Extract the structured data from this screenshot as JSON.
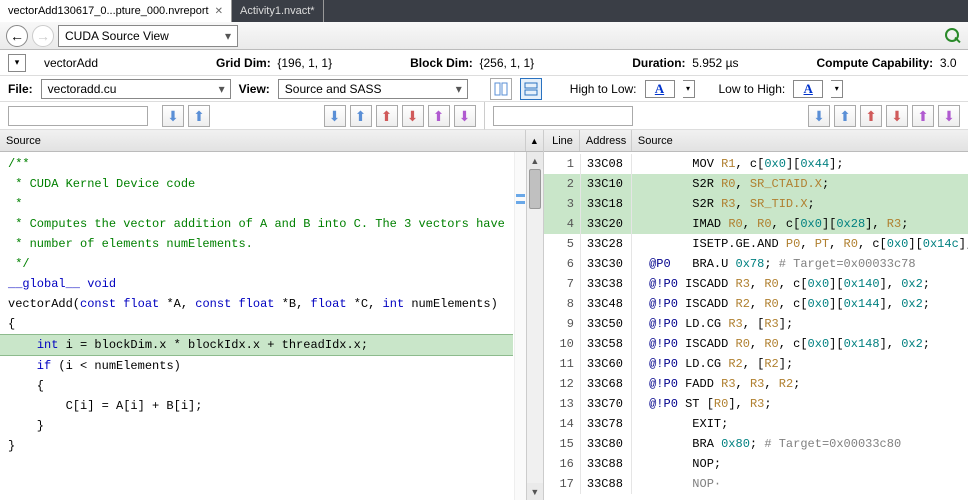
{
  "tabs": [
    {
      "label": "vectorAdd130617_0...pture_000.nvreport",
      "active": true
    },
    {
      "label": "Activity1.nvact*",
      "active": false
    }
  ],
  "toolbar": {
    "view_combo": "CUDA Source View"
  },
  "info": {
    "kernel": "vectorAdd",
    "grid_label": "Grid Dim:",
    "grid_value": "{196, 1, 1}",
    "block_label": "Block Dim:",
    "block_value": "{256, 1, 1}",
    "duration_label": "Duration:",
    "duration_value": "5.952  µs",
    "cc_label": "Compute Capability:",
    "cc_value": "3.0"
  },
  "filter": {
    "file_label": "File:",
    "file_value": "vectoradd.cu",
    "view_label": "View:",
    "view_value": "Source and SASS",
    "htl_label": "High to Low:",
    "lth_label": "Low to High:",
    "swatch_text": "A"
  },
  "left_header": "Source",
  "right_header": {
    "c1": "Line",
    "c2": "Address",
    "c3": "Source"
  },
  "source_lines": [
    {
      "t": "",
      "c": ""
    },
    {
      "t": "/**",
      "c": "c-green"
    },
    {
      "t": " * CUDA Kernel Device code",
      "c": "c-green"
    },
    {
      "t": " *",
      "c": "c-green"
    },
    {
      "t": " * Computes the vector addition of A and B into C. The 3 vectors have",
      "c": "c-green"
    },
    {
      "t": " * number of elements numElements.",
      "c": "c-green"
    },
    {
      "t": " */",
      "c": "c-green"
    },
    {
      "t": "__global__",
      "c": "c-blue",
      "tail": " void",
      "tailc": "c-blue"
    },
    {
      "t": "vectorAdd(",
      "after": [
        {
          "t": "const",
          "c": "c-blue"
        },
        {
          "t": " "
        },
        {
          "t": "float",
          "c": "c-blue"
        },
        {
          "t": " *A, "
        },
        {
          "t": "const",
          "c": "c-blue"
        },
        {
          "t": " "
        },
        {
          "t": "float",
          "c": "c-blue"
        },
        {
          "t": " *B, "
        },
        {
          "t": "float",
          "c": "c-blue"
        },
        {
          "t": " *C, "
        },
        {
          "t": "int",
          "c": "c-blue"
        },
        {
          "t": " numElements)"
        }
      ]
    },
    {
      "t": "{",
      "c": ""
    },
    {
      "hl": true,
      "segs": [
        {
          "t": "    "
        },
        {
          "t": "int",
          "c": "c-blue"
        },
        {
          "t": " i = blockDim.x * blockIdx.x + threadIdx.x;"
        }
      ]
    },
    {
      "t": "",
      "c": ""
    },
    {
      "t": "    if",
      "c": "c-blue",
      "tail": " (i < numElements)",
      "tailc": ""
    },
    {
      "t": "    {",
      "c": ""
    },
    {
      "t": "        C[i] = A[i] + B[i];",
      "c": ""
    },
    {
      "t": "    }",
      "c": ""
    },
    {
      "t": "}",
      "c": ""
    }
  ],
  "asm_lines": [
    {
      "ln": 1,
      "addr": "33C08",
      "hl": false,
      "segs": [
        {
          "t": "       MOV "
        },
        {
          "t": "R1",
          "c": "c-tan"
        },
        {
          "t": ", c["
        },
        {
          "t": "0x0",
          "c": "c-teal"
        },
        {
          "t": "]["
        },
        {
          "t": "0x44",
          "c": "c-teal"
        },
        {
          "t": "];"
        }
      ]
    },
    {
      "ln": 2,
      "addr": "33C10",
      "hl": true,
      "segs": [
        {
          "t": "       S2R "
        },
        {
          "t": "R0",
          "c": "c-tan"
        },
        {
          "t": ", "
        },
        {
          "t": "SR_CTAID.X",
          "c": "c-tan"
        },
        {
          "t": ";"
        }
      ]
    },
    {
      "ln": 3,
      "addr": "33C18",
      "hl": true,
      "segs": [
        {
          "t": "       S2R "
        },
        {
          "t": "R3",
          "c": "c-tan"
        },
        {
          "t": ", "
        },
        {
          "t": "SR_TID.X",
          "c": "c-tan"
        },
        {
          "t": ";"
        }
      ]
    },
    {
      "ln": 4,
      "addr": "33C20",
      "hl": true,
      "segs": [
        {
          "t": "       IMAD "
        },
        {
          "t": "R0",
          "c": "c-tan"
        },
        {
          "t": ", "
        },
        {
          "t": "R0",
          "c": "c-tan"
        },
        {
          "t": ", c["
        },
        {
          "t": "0x0",
          "c": "c-teal"
        },
        {
          "t": "]["
        },
        {
          "t": "0x28",
          "c": "c-teal"
        },
        {
          "t": "], "
        },
        {
          "t": "R3",
          "c": "c-tan"
        },
        {
          "t": ";"
        }
      ]
    },
    {
      "ln": 5,
      "addr": "33C28",
      "hl": false,
      "segs": [
        {
          "t": "       ISETP.GE.AND "
        },
        {
          "t": "P0",
          "c": "c-tan"
        },
        {
          "t": ", "
        },
        {
          "t": "PT",
          "c": "c-tan"
        },
        {
          "t": ", "
        },
        {
          "t": "R0",
          "c": "c-tan"
        },
        {
          "t": ", c["
        },
        {
          "t": "0x0",
          "c": "c-teal"
        },
        {
          "t": "]["
        },
        {
          "t": "0x14c",
          "c": "c-teal"
        },
        {
          "t": "], "
        },
        {
          "t": "PT",
          "c": "c-tan"
        },
        {
          "t": ";"
        }
      ]
    },
    {
      "ln": 6,
      "addr": "33C30",
      "hl": false,
      "segs": [
        {
          "t": " ",
          "c": ""
        },
        {
          "t": "@P0",
          "c": "c-dkblue"
        },
        {
          "t": "   BRA.U "
        },
        {
          "t": "0x78",
          "c": "c-teal"
        },
        {
          "t": "; "
        },
        {
          "t": "# Target=0x00033c78",
          "c": "c-gray"
        }
      ]
    },
    {
      "ln": 7,
      "addr": "33C38",
      "hl": false,
      "segs": [
        {
          "t": " ",
          "c": ""
        },
        {
          "t": "@!P0",
          "c": "c-dkblue"
        },
        {
          "t": " ISCADD "
        },
        {
          "t": "R3",
          "c": "c-tan"
        },
        {
          "t": ", "
        },
        {
          "t": "R0",
          "c": "c-tan"
        },
        {
          "t": ", c["
        },
        {
          "t": "0x0",
          "c": "c-teal"
        },
        {
          "t": "]["
        },
        {
          "t": "0x140",
          "c": "c-teal"
        },
        {
          "t": "], "
        },
        {
          "t": "0x2",
          "c": "c-teal"
        },
        {
          "t": ";"
        }
      ]
    },
    {
      "ln": 8,
      "addr": "33C48",
      "hl": false,
      "segs": [
        {
          "t": " ",
          "c": ""
        },
        {
          "t": "@!P0",
          "c": "c-dkblue"
        },
        {
          "t": " ISCADD "
        },
        {
          "t": "R2",
          "c": "c-tan"
        },
        {
          "t": ", "
        },
        {
          "t": "R0",
          "c": "c-tan"
        },
        {
          "t": ", c["
        },
        {
          "t": "0x0",
          "c": "c-teal"
        },
        {
          "t": "]["
        },
        {
          "t": "0x144",
          "c": "c-teal"
        },
        {
          "t": "], "
        },
        {
          "t": "0x2",
          "c": "c-teal"
        },
        {
          "t": ";"
        }
      ]
    },
    {
      "ln": 9,
      "addr": "33C50",
      "hl": false,
      "segs": [
        {
          "t": " ",
          "c": ""
        },
        {
          "t": "@!P0",
          "c": "c-dkblue"
        },
        {
          "t": " LD.CG "
        },
        {
          "t": "R3",
          "c": "c-tan"
        },
        {
          "t": ", ["
        },
        {
          "t": "R3",
          "c": "c-tan"
        },
        {
          "t": "];"
        }
      ]
    },
    {
      "ln": 10,
      "addr": "33C58",
      "hl": false,
      "segs": [
        {
          "t": " ",
          "c": ""
        },
        {
          "t": "@!P0",
          "c": "c-dkblue"
        },
        {
          "t": " ISCADD "
        },
        {
          "t": "R0",
          "c": "c-tan"
        },
        {
          "t": ", "
        },
        {
          "t": "R0",
          "c": "c-tan"
        },
        {
          "t": ", c["
        },
        {
          "t": "0x0",
          "c": "c-teal"
        },
        {
          "t": "]["
        },
        {
          "t": "0x148",
          "c": "c-teal"
        },
        {
          "t": "], "
        },
        {
          "t": "0x2",
          "c": "c-teal"
        },
        {
          "t": ";"
        }
      ]
    },
    {
      "ln": 11,
      "addr": "33C60",
      "hl": false,
      "segs": [
        {
          "t": " ",
          "c": ""
        },
        {
          "t": "@!P0",
          "c": "c-dkblue"
        },
        {
          "t": " LD.CG "
        },
        {
          "t": "R2",
          "c": "c-tan"
        },
        {
          "t": ", ["
        },
        {
          "t": "R2",
          "c": "c-tan"
        },
        {
          "t": "];"
        }
      ]
    },
    {
      "ln": 12,
      "addr": "33C68",
      "hl": false,
      "segs": [
        {
          "t": " ",
          "c": ""
        },
        {
          "t": "@!P0",
          "c": "c-dkblue"
        },
        {
          "t": " FADD "
        },
        {
          "t": "R3",
          "c": "c-tan"
        },
        {
          "t": ", "
        },
        {
          "t": "R3",
          "c": "c-tan"
        },
        {
          "t": ", "
        },
        {
          "t": "R2",
          "c": "c-tan"
        },
        {
          "t": ";"
        }
      ]
    },
    {
      "ln": 13,
      "addr": "33C70",
      "hl": false,
      "segs": [
        {
          "t": " ",
          "c": ""
        },
        {
          "t": "@!P0",
          "c": "c-dkblue"
        },
        {
          "t": " ST ["
        },
        {
          "t": "R0",
          "c": "c-tan"
        },
        {
          "t": "], "
        },
        {
          "t": "R3",
          "c": "c-tan"
        },
        {
          "t": ";"
        }
      ]
    },
    {
      "ln": 14,
      "addr": "33C78",
      "hl": false,
      "segs": [
        {
          "t": "       EXIT;"
        }
      ]
    },
    {
      "ln": 15,
      "addr": "33C80",
      "hl": false,
      "segs": [
        {
          "t": "       BRA "
        },
        {
          "t": "0x80",
          "c": "c-teal"
        },
        {
          "t": "; "
        },
        {
          "t": "# Target=0x00033c80",
          "c": "c-gray"
        }
      ]
    },
    {
      "ln": 16,
      "addr": "33C88",
      "hl": false,
      "segs": [
        {
          "t": "       NOP;"
        }
      ]
    },
    {
      "ln": 17,
      "addr": "33C88",
      "hl": false,
      "segs": [
        {
          "t": "       NOP·",
          "c": "c-gray"
        }
      ]
    }
  ]
}
